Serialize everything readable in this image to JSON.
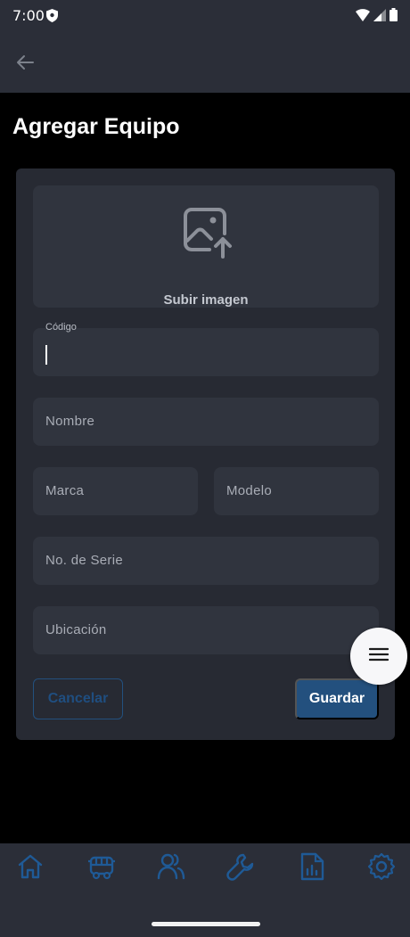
{
  "status_bar": {
    "time": "7:00"
  },
  "page": {
    "title": "Agregar Equipo"
  },
  "upload": {
    "label": "Subir imagen",
    "icon": "image-upload-icon"
  },
  "form": {
    "codigo": {
      "label": "Código",
      "value": ""
    },
    "nombre": {
      "placeholder": "Nombre"
    },
    "marca": {
      "placeholder": "Marca"
    },
    "modelo": {
      "placeholder": "Modelo"
    },
    "serie": {
      "placeholder": "No. de Serie"
    },
    "ubicacion": {
      "placeholder": "Ubicación"
    }
  },
  "actions": {
    "cancel_label": "Cancelar",
    "save_label": "Guardar"
  },
  "fab": {
    "icon": "menu-icon"
  },
  "bottom_nav": {
    "items": [
      {
        "icon": "home-icon"
      },
      {
        "icon": "bus-icon"
      },
      {
        "icon": "users-icon"
      },
      {
        "icon": "wrench-icon"
      },
      {
        "icon": "report-icon"
      },
      {
        "icon": "gear-icon"
      }
    ]
  },
  "colors": {
    "background": "#000000",
    "bar": "#2b2e38",
    "card": "#272a33",
    "field": "#30343e",
    "accent": "#23507e",
    "nav_icon": "#1f5a96"
  }
}
